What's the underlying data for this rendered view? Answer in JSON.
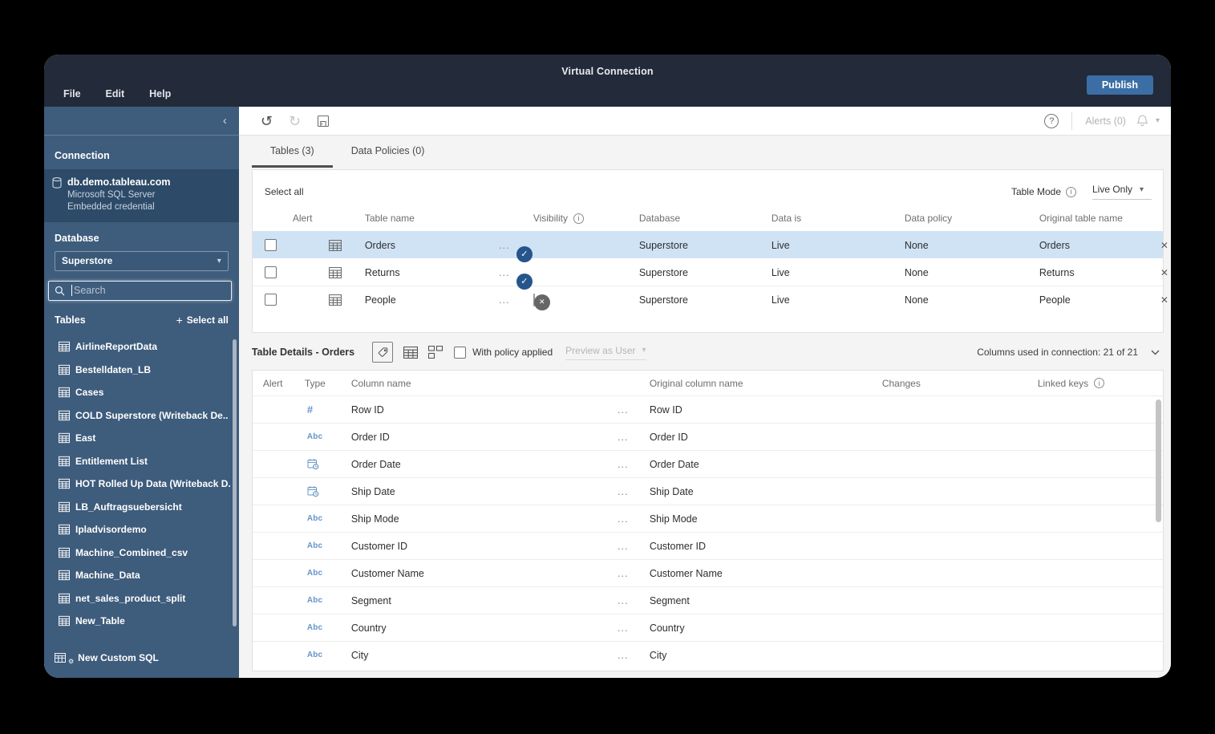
{
  "topbar": {
    "title": "Virtual Connection",
    "publish": "Publish",
    "menus": [
      "File",
      "Edit",
      "Help"
    ]
  },
  "toolbar": {
    "alerts": "Alerts (0)"
  },
  "icons": {
    "undo": "↺",
    "redo": "↻",
    "collapse": "‹",
    "plus": "+",
    "menu_ellipsis": "...",
    "close": "✕",
    "check": "✓",
    "dropdown_chevron": "▾",
    "question": "?",
    "info": "i"
  },
  "sidebar": {
    "connection_header": "Connection",
    "server_name": "db.demo.tableau.com",
    "server_type": "Microsoft SQL Server",
    "server_credential": "Embedded credential",
    "database_label": "Database",
    "database_value": "Superstore",
    "search_placeholder": "Search",
    "tables_label": "Tables",
    "select_all": "Select all",
    "tables": [
      "AirlineReportData",
      "Bestelldaten_LB",
      "Cases",
      "COLD Superstore (Writeback De..",
      "East",
      "Entitlement List",
      "HOT Rolled Up Data (Writeback D.",
      "LB_Auftragsuebersicht",
      "Ipladvisordemo",
      "Machine_Combined_csv",
      "Machine_Data",
      "net_sales_product_split",
      "New_Table"
    ],
    "new_custom_sql": "New Custom SQL"
  },
  "tabs": {
    "tables": "Tables (3)",
    "policies": "Data Policies (0)"
  },
  "tables_panel": {
    "select_all": "Select all",
    "table_mode": "Table Mode",
    "mode_value": "Live Only",
    "headers": {
      "alert": "Alert",
      "table_name": "Table name",
      "visibility": "Visibility",
      "database": "Database",
      "data_is": "Data is",
      "data_policy": "Data policy",
      "original": "Original table name"
    },
    "rows": [
      {
        "name": "Orders",
        "visible": true,
        "database": "Superstore",
        "data_is": "Live",
        "policy": "None",
        "original": "Orders",
        "selected": true
      },
      {
        "name": "Returns",
        "visible": true,
        "database": "Superstore",
        "data_is": "Live",
        "policy": "None",
        "original": "Returns",
        "selected": false
      },
      {
        "name": "People",
        "visible": false,
        "database": "Superstore",
        "data_is": "Live",
        "policy": "None",
        "original": "People",
        "selected": false
      }
    ]
  },
  "details_panel": {
    "title": "Table Details - Orders",
    "with_policy": "With policy applied",
    "preview_as": "Preview as User",
    "columns_used": "Columns used in connection: 21 of 21",
    "headers": {
      "alert": "Alert",
      "type": "Type",
      "column_name": "Column name",
      "original": "Original column name",
      "changes": "Changes",
      "linked_keys": "Linked keys"
    },
    "rows": [
      {
        "type": "number",
        "name": "Row ID",
        "original": "Row ID"
      },
      {
        "type": "string",
        "name": "Order ID",
        "original": "Order ID"
      },
      {
        "type": "date",
        "name": "Order Date",
        "original": "Order Date"
      },
      {
        "type": "date",
        "name": "Ship Date",
        "original": "Ship Date"
      },
      {
        "type": "string",
        "name": "Ship Mode",
        "original": "Ship Mode"
      },
      {
        "type": "string",
        "name": "Customer ID",
        "original": "Customer ID"
      },
      {
        "type": "string",
        "name": "Customer Name",
        "original": "Customer Name"
      },
      {
        "type": "string",
        "name": "Segment",
        "original": "Segment"
      },
      {
        "type": "string",
        "name": "Country",
        "original": "Country"
      },
      {
        "type": "string",
        "name": "City",
        "original": "City"
      }
    ]
  },
  "colors": {
    "topbar": "#232a39",
    "sidebar": "#3e5c7c",
    "sidebar_selected": "#2d4a68",
    "accent_button": "#3b6ea5",
    "selected_row": "#d0e3f5",
    "toggle_on_track": "#a9c8e9",
    "toggle_on_knob": "#26558c",
    "type_icon_blue": "#6496c8"
  }
}
